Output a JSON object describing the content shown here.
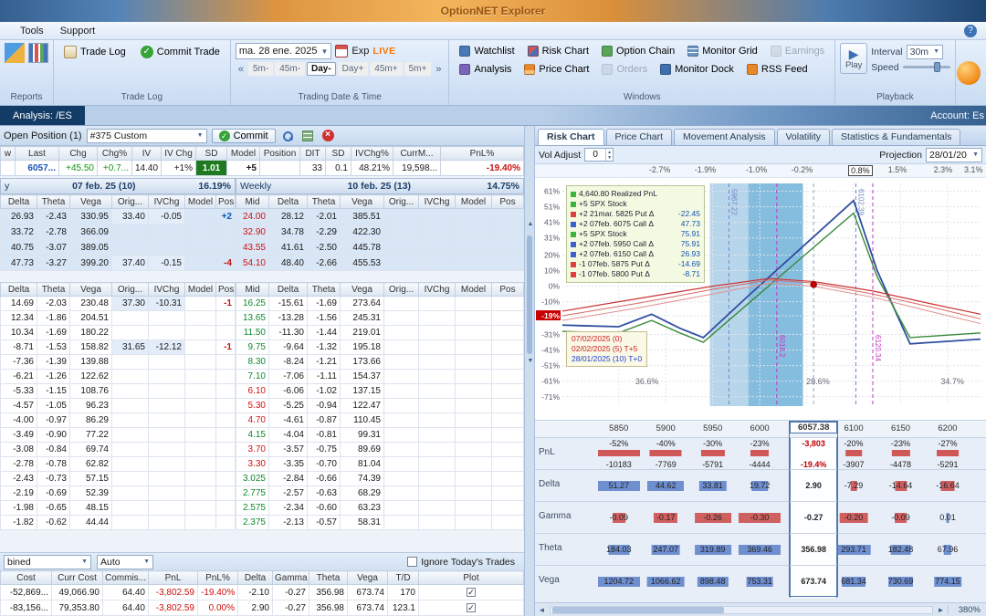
{
  "title_bar": {
    "title": "OptionNET Explorer"
  },
  "menu": {
    "tools": "Tools",
    "support": "Support"
  },
  "toolbar": {
    "reports_group": "Reports",
    "trade_log_btn": "Trade Log",
    "commit_trade_btn": "Commit Trade",
    "trade_log_group": "Trade Log",
    "date_value": "ma. 28 ene. 2025",
    "exp_label": "Exp",
    "live_label": "LIVE",
    "nav": [
      "5m-",
      "45m-",
      "Day-",
      "Day+",
      "45m+",
      "5m+"
    ],
    "trading_group": "Trading Date & Time",
    "windows_row1": [
      "Watchlist",
      "Risk Chart",
      "Option Chain",
      "Monitor Grid",
      "Earnings"
    ],
    "windows_row2": [
      "Analysis",
      "Price Chart",
      "Orders",
      "Monitor Dock",
      "RSS Feed"
    ],
    "windows_group": "Windows",
    "play_label": "Play",
    "interval_label": "Interval",
    "interval_value": "30m",
    "speed_label": "Speed",
    "playback_group": "Playback"
  },
  "analysis_bar": {
    "tab": "Analysis: /ES",
    "account": "Account: Es"
  },
  "position_bar": {
    "label": "Open Position (1)",
    "strategy": "#375 Custom",
    "commit": "Commit"
  },
  "summary": {
    "headers": [
      "w",
      "Last",
      "Chg",
      "Chg%",
      "IV",
      "IV Chg",
      "SD",
      "Model",
      "Position",
      "DIT",
      "SD",
      "IVChg%",
      "CurrM...",
      "PnL%"
    ],
    "row": [
      "",
      "6057...",
      "+45.50",
      "+0.7...",
      "14.40",
      "+1%",
      "1.01",
      "+5",
      "",
      "33",
      "0.1",
      "48.21%",
      "19,598...",
      "-19.40%"
    ]
  },
  "chain1": {
    "group_left": {
      "prefix": "y",
      "title": "07 feb. 25 (10)",
      "iv": "16.19%"
    },
    "group_right": {
      "prefix": "Weekly",
      "title": "10 feb. 25 (13)",
      "iv": "14.75%"
    },
    "left_headers": [
      "Delta",
      "Theta",
      "Vega",
      "Orig...",
      "IVChg",
      "Model",
      "Pos"
    ],
    "right_headers": [
      "Mid",
      "Delta",
      "Theta",
      "Vega",
      "Orig...",
      "IVChg",
      "Model",
      "Pos"
    ],
    "left_rows": [
      [
        "26.93",
        "-2.43",
        "330.95",
        "33.40",
        "-0.05",
        "",
        "+2"
      ],
      [
        "33.72",
        "-2.78",
        "366.09",
        "",
        "",
        "",
        ""
      ],
      [
        "40.75",
        "-3.07",
        "389.05",
        "",
        "",
        "",
        ""
      ],
      [
        "47.73",
        "-3.27",
        "399.20",
        "37.40",
        "-0.15",
        "",
        "-4"
      ]
    ],
    "right_rows": [
      [
        "24.00",
        "28.12",
        "-2.01",
        "385.51",
        "",
        "",
        "",
        ""
      ],
      [
        "32.90",
        "34.78",
        "-2.29",
        "422.30",
        "",
        "",
        "",
        ""
      ],
      [
        "43.55",
        "41.61",
        "-2.50",
        "445.78",
        "",
        "",
        "",
        ""
      ],
      [
        "54.10",
        "48.40",
        "-2.66",
        "455.53",
        "",
        "",
        "",
        ""
      ]
    ],
    "right_mid_colors": [
      "down",
      "down",
      "down",
      "down"
    ]
  },
  "chain2": {
    "left_headers": [
      "Delta",
      "Theta",
      "Vega",
      "Orig...",
      "IVChg",
      "Model",
      "Pos"
    ],
    "right_headers": [
      "Mid",
      "Delta",
      "Theta",
      "Vega",
      "Orig...",
      "IVChg",
      "Model",
      "Pos"
    ],
    "left_rows": [
      [
        "14.69",
        "-2.03",
        "230.48",
        "37.30",
        "-10.31",
        "",
        "-1"
      ],
      [
        "12.34",
        "-1.86",
        "204.51",
        "",
        "",
        "",
        ""
      ],
      [
        "10.34",
        "-1.69",
        "180.22",
        "",
        "",
        "",
        ""
      ],
      [
        "-8.71",
        "-1.53",
        "158.82",
        "31.65",
        "-12.12",
        "",
        "-1"
      ],
      [
        "-7.36",
        "-1.39",
        "139.88",
        "",
        "",
        "",
        ""
      ],
      [
        "-6.21",
        "-1.26",
        "122.62",
        "",
        "",
        "",
        ""
      ],
      [
        "-5.33",
        "-1.15",
        "108.76",
        "",
        "",
        "",
        ""
      ],
      [
        "-4.57",
        "-1.05",
        "96.23",
        "",
        "",
        "",
        ""
      ],
      [
        "-4.00",
        "-0.97",
        "86.29",
        "",
        "",
        "",
        ""
      ],
      [
        "-3.49",
        "-0.90",
        "77.22",
        "",
        "",
        "",
        ""
      ],
      [
        "-3.08",
        "-0.84",
        "69.74",
        "",
        "",
        "",
        ""
      ],
      [
        "-2.78",
        "-0.78",
        "62.82",
        "",
        "",
        "",
        ""
      ],
      [
        "-2.43",
        "-0.73",
        "57.15",
        "",
        "",
        "",
        ""
      ],
      [
        "-2.19",
        "-0.69",
        "52.39",
        "",
        "",
        "",
        ""
      ],
      [
        "-1.98",
        "-0.65",
        "48.15",
        "",
        "",
        "",
        ""
      ],
      [
        "-1.82",
        "-0.62",
        "44.44",
        "",
        "",
        "",
        ""
      ]
    ],
    "right_rows": [
      [
        "16.25",
        "-15.61",
        "-1.69",
        "273.64",
        "",
        "",
        "",
        ""
      ],
      [
        "13.65",
        "-13.28",
        "-1.56",
        "245.31",
        "",
        "",
        "",
        ""
      ],
      [
        "11.50",
        "-11.30",
        "-1.44",
        "219.01",
        "",
        "",
        "",
        ""
      ],
      [
        "9.75",
        "-9.64",
        "-1.32",
        "195.18",
        "",
        "",
        "",
        ""
      ],
      [
        "8.30",
        "-8.24",
        "-1.21",
        "173.66",
        "",
        "",
        "",
        ""
      ],
      [
        "7.10",
        "-7.06",
        "-1.11",
        "154.37",
        "",
        "",
        "",
        ""
      ],
      [
        "6.10",
        "-6.06",
        "-1.02",
        "137.15",
        "",
        "",
        "",
        ""
      ],
      [
        "5.30",
        "-5.25",
        "-0.94",
        "122.47",
        "",
        "",
        "",
        ""
      ],
      [
        "4.70",
        "-4.61",
        "-0.87",
        "110.45",
        "",
        "",
        "",
        ""
      ],
      [
        "4.15",
        "-4.04",
        "-0.81",
        "99.31",
        "",
        "",
        "",
        ""
      ],
      [
        "3.70",
        "-3.57",
        "-0.75",
        "89.69",
        "",
        "",
        "",
        ""
      ],
      [
        "3.30",
        "-3.35",
        "-0.70",
        "81.04",
        "",
        "",
        "",
        ""
      ],
      [
        "3.025",
        "-2.84",
        "-0.66",
        "74.39",
        "",
        "",
        "",
        ""
      ],
      [
        "2.775",
        "-2.57",
        "-0.63",
        "68.29",
        "",
        "",
        "",
        ""
      ],
      [
        "2.575",
        "-2.34",
        "-0.60",
        "63.23",
        "",
        "",
        "",
        ""
      ],
      [
        "2.375",
        "-2.13",
        "-0.57",
        "58.31",
        "",
        "",
        "",
        ""
      ]
    ],
    "right_mid_colors": [
      "up",
      "up",
      "up",
      "up",
      "up",
      "up",
      "down",
      "down",
      "down",
      "up",
      "down",
      "down",
      "up",
      "up",
      "up",
      "up"
    ]
  },
  "footer": {
    "combo1": "bined",
    "combo2": "Auto",
    "ignore": "Ignore Today's Trades"
  },
  "totals": {
    "headers": [
      "Cost",
      "Curr Cost",
      "Commis...",
      "PnL",
      "PnL%",
      "Delta",
      "Gamma",
      "Theta",
      "Vega",
      "T/D",
      "Plot"
    ],
    "rows": [
      [
        "-52,869...",
        "49,066.90",
        "64.40",
        "-3,802.59",
        "-19.40%",
        "-2.10",
        "-0.27",
        "356.98",
        "673.74",
        "170",
        ""
      ],
      [
        "-83,156...",
        "79,353.80",
        "64.40",
        "-3,802.59",
        "0.00%",
        "2.90",
        "-0.27",
        "356.98",
        "673.74",
        "123.1",
        ""
      ]
    ]
  },
  "risk_tabs": [
    "Risk Chart",
    "Price Chart",
    "Movement Analysis",
    "Volatility",
    "Statistics & Fundamentals"
  ],
  "vol_row": {
    "label": "Vol Adjust",
    "value": "0",
    "projection_label": "Projection",
    "projection_value": "28/01/20"
  },
  "zoom_label": "380%",
  "chart_data": {
    "type": "line",
    "title": "Risk graph (PnL% vs underlying price)",
    "x_range": [
      5790,
      6235
    ],
    "x_labels": [
      "5850",
      "5900",
      "5950",
      "6000",
      "6100",
      "6150",
      "6200"
    ],
    "current_price": "6057.38",
    "top_axis_pct": [
      "-2.7%",
      "-1.9%",
      "-1.0%",
      "-0.2%",
      "0.8%",
      "1.5%",
      "2.3%",
      "3.1%"
    ],
    "top_axis_selected": "0.8%",
    "y_ticks": [
      61,
      51,
      41,
      31,
      20,
      10,
      0,
      -10,
      -19,
      -31,
      -41,
      -51,
      -61,
      -71
    ],
    "y_highlight": -19,
    "legend": {
      "realized": "4,640.80 Realized PnL",
      "items": [
        {
          "qty": "+5",
          "label": "SPX Stock",
          "delta": "",
          "marker": "#3db53d"
        },
        {
          "qty": "+2",
          "label": "21mar. 5825 Put Δ",
          "delta": "-22.45",
          "marker": "#e04040"
        },
        {
          "qty": "+2",
          "label": "07feb. 6075 Call Δ",
          "delta": "47.73",
          "marker": "#4060d0"
        },
        {
          "qty": "+5",
          "label": "SPX Stock",
          "delta": "75.91",
          "marker": "#3db53d"
        },
        {
          "qty": "+2",
          "label": "07feb. 5950 Call Δ",
          "delta": "75.91",
          "marker": "#4060d0"
        },
        {
          "qty": "+2",
          "label": "07feb. 6150 Call Δ",
          "delta": "26.93",
          "marker": "#4060d0"
        },
        {
          "qty": "-1",
          "label": "07feb. 5875 Put Δ",
          "delta": "-14.69",
          "marker": "#e04040"
        },
        {
          "qty": "-1",
          "label": "07feb. 5800 Put Δ",
          "delta": "-8.71",
          "marker": "#e04040"
        }
      ]
    },
    "bands": [
      {
        "x1": 5947,
        "x2": 6046,
        "color": "#aacfe8"
      },
      {
        "x1": 5988,
        "x2": 6046,
        "color": "#7db9dd"
      }
    ],
    "vlines": [
      {
        "x": 5967.22,
        "label": "5967.22",
        "color": "#6f86c9",
        "label_pos": "top"
      },
      {
        "x": 6102.39,
        "label": "6102.39",
        "color": "#6f86c9",
        "label_pos": "top"
      },
      {
        "x": 6018.2,
        "label": "6018.2",
        "color": "#c238c2",
        "label_pos": "bottom"
      },
      {
        "x": 6120.34,
        "label": "6120.34",
        "color": "#c238c2",
        "label_pos": "bottom"
      },
      {
        "x": 6057.38,
        "label": "",
        "color": "#9aa6b8",
        "label_pos": "none"
      }
    ],
    "prob_labels": [
      {
        "x": 5880,
        "text": "36.6%"
      },
      {
        "x": 6062,
        "text": "28.6%"
      },
      {
        "x": 6205,
        "text": "34.7%"
      }
    ],
    "date_box": [
      {
        "text": "07/02/2025 (0)",
        "color": "#cc2222"
      },
      {
        "text": "02/02/2025 (5) T+5",
        "color": "#cc2222"
      },
      {
        "text": "28/01/2025 (10) T+0",
        "color": "#2244cc"
      }
    ],
    "series": [
      {
        "name": "expiration-line",
        "color": "#2f4f9f",
        "width": 1.8,
        "x": [
          5790,
          5850,
          5885,
          5915,
          5940,
          5990,
          6100,
          6125,
          6160,
          6235
        ],
        "y": [
          -25,
          -26,
          -18,
          -27,
          -33,
          -5,
          55,
          10,
          -37,
          -34
        ]
      },
      {
        "name": "t5-line",
        "color": "#3a8a3a",
        "width": 1.4,
        "x": [
          5790,
          5850,
          5885,
          5915,
          5940,
          5990,
          6100,
          6125,
          6160,
          6235
        ],
        "y": [
          -29,
          -30,
          -22,
          -30,
          -36,
          -10,
          47,
          6,
          -33,
          -30
        ]
      },
      {
        "name": "t0-line-1",
        "color": "#cc3333",
        "width": 1.2,
        "x": [
          5790,
          5870,
          5950,
          6010,
          6057,
          6120,
          6180,
          6235
        ],
        "y": [
          -16,
          -8,
          0,
          5,
          3,
          -3,
          -11,
          -18
        ]
      },
      {
        "name": "t0-line-2",
        "color": "#d96666",
        "width": 1,
        "x": [
          5790,
          5870,
          5950,
          6010,
          6057,
          6120,
          6180,
          6235
        ],
        "y": [
          -19,
          -11,
          -2,
          4,
          2,
          -5,
          -13,
          -21
        ]
      },
      {
        "name": "t0-line-3",
        "color": "#e09090",
        "width": 1,
        "x": [
          5790,
          5870,
          5950,
          6010,
          6057,
          6120,
          6180,
          6235
        ],
        "y": [
          -22,
          -14,
          -5,
          2,
          0,
          -7,
          -16,
          -24
        ]
      }
    ],
    "dot": {
      "x": 6057.38,
      "y": 1,
      "color": "#d40000"
    },
    "greeks": {
      "row_labels": [
        "PnL",
        "Delta",
        "Gamma",
        "Theta",
        "Vega"
      ],
      "columns": [
        "5850",
        "5900",
        "5950",
        "6000",
        "6057.38",
        "6100",
        "6150",
        "6200"
      ],
      "column_prices": [
        5850,
        5900,
        5950,
        6000,
        6057.38,
        6100,
        6150,
        6200
      ],
      "current_index": 4,
      "pnl_pct": [
        "-52%",
        "-40%",
        "-30%",
        "-23%",
        "-19.4%",
        "-20%",
        "-23%",
        "-27%"
      ],
      "pnl_val": [
        "-10183",
        "-7769",
        "-5791",
        "-4444",
        "-3,803",
        "-3907",
        "-4478",
        "-5291"
      ],
      "delta": [
        "51.27",
        "44.62",
        "33.81",
        "19.72",
        "2.90",
        "-7.29",
        "-14.64",
        "-16.64"
      ],
      "gamma": [
        "-0.09",
        "-0.17",
        "-0.26",
        "-0.30",
        "-0.27",
        "-0.20",
        "-0.09",
        "0.01"
      ],
      "theta": [
        "184.03",
        "247.07",
        "319.89",
        "369.46",
        "356.98",
        "293.71",
        "182.48",
        "67.96"
      ],
      "vega": [
        "1204.72",
        "1066.62",
        "898.48",
        "753.31",
        "673.74",
        "681.34",
        "730.69",
        "774.15"
      ]
    }
  }
}
